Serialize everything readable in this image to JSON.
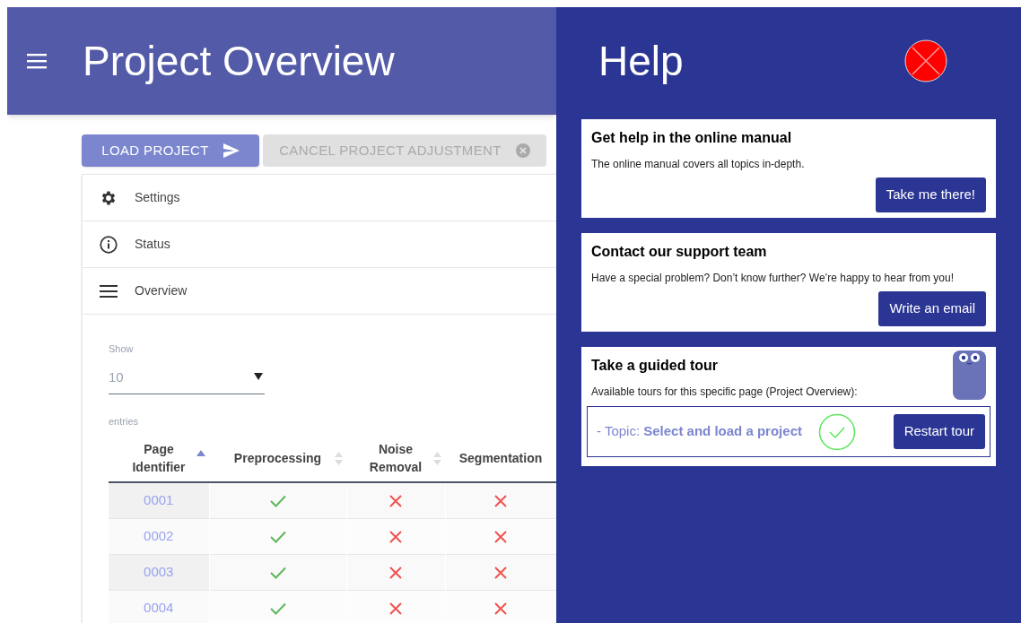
{
  "header": {
    "title": "Project Overview"
  },
  "actions": [
    {
      "kind": "primary",
      "label": "LOAD PROJECT",
      "disabled": false
    },
    {
      "kind": "cancel",
      "label": "CANCEL PROJECT ADJUSTMENT",
      "disabled": true
    }
  ],
  "nav_items": [
    {
      "kind": "settings",
      "label": "Settings"
    },
    {
      "kind": "status",
      "label": "Status"
    },
    {
      "kind": "overview",
      "label": "Overview"
    }
  ],
  "entries_select": {
    "label_before": "Show",
    "value": "10",
    "label_after": "entries"
  },
  "table": {
    "columns": [
      {
        "label": "Page Identifier",
        "sorted": true
      },
      {
        "label": "Preprocessing",
        "sorted": false
      },
      {
        "label": "Noise Removal",
        "sorted": false
      },
      {
        "label": "Segmentation"
      }
    ],
    "rows": [
      {
        "id": "0001",
        "steps": [
          true,
          false,
          false
        ]
      },
      {
        "id": "0002",
        "steps": [
          true,
          false,
          false
        ]
      },
      {
        "id": "0003",
        "steps": [
          true,
          false,
          false
        ]
      },
      {
        "id": "0004",
        "steps": [
          true,
          false,
          false
        ]
      }
    ]
  },
  "help": {
    "title": "Help",
    "cards": [
      {
        "title": "Get help in the online manual",
        "text": "The online manual covers all topics in-depth.",
        "button": "Take me there!"
      },
      {
        "title": "Contact our support team",
        "text": "Have a special problem? Don’t know further? We’re happy to hear from you!",
        "button": "Write an email"
      }
    ],
    "tour": {
      "title": "Take a guided tour",
      "text": "Available tours for this specific page (Project Overview):",
      "topics": [
        {
          "label": "- Topic: **Select and load a project**",
          "completed": true,
          "button": "Restart tour"
        }
      ]
    }
  }
}
